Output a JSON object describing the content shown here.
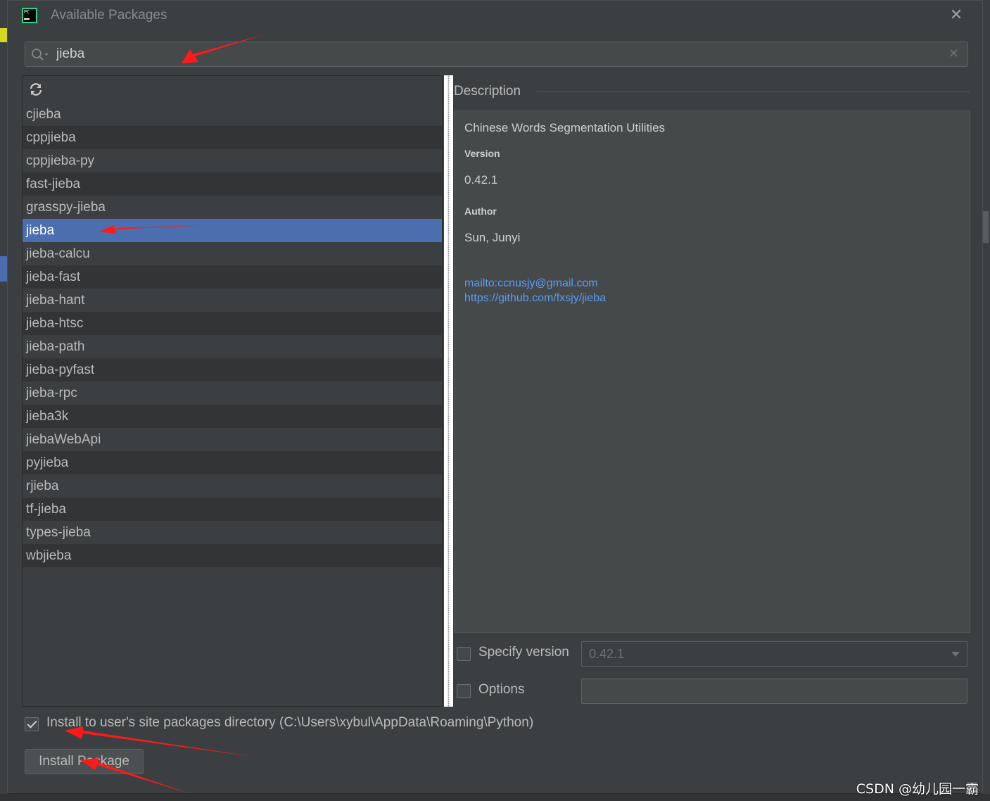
{
  "window": {
    "title": "Available Packages",
    "app_icon_text": "PC"
  },
  "search": {
    "value": "jieba"
  },
  "packages": [
    "cjieba",
    "cppjieba",
    "cppjieba-py",
    "fast-jieba",
    "grasspy-jieba",
    "jieba",
    "jieba-calcu",
    "jieba-fast",
    "jieba-hant",
    "jieba-htsc",
    "jieba-path",
    "jieba-pyfast",
    "jieba-rpc",
    "jieba3k",
    "jiebaWebApi",
    "pyjieba",
    "rjieba",
    "tf-jieba",
    "types-jieba",
    "wbjieba"
  ],
  "selected_package": "jieba",
  "description": {
    "label": "Description",
    "summary": "Chinese Words Segmentation Utilities",
    "version_heading": "Version",
    "version": "0.42.1",
    "author_heading": "Author",
    "author": "Sun, Junyi",
    "links": [
      "mailto:ccnusjy@gmail.com",
      "https://github.com/fxsjy/jieba"
    ]
  },
  "options": {
    "specify_version_label": "Specify version",
    "specify_version_checked": false,
    "version_value": "0.42.1",
    "options_label": "Options",
    "options_checked": false,
    "options_value": "",
    "install_user_label": "Install to user's site packages directory (C:\\Users\\xybul\\AppData\\Roaming\\Python)",
    "install_user_checked": true
  },
  "buttons": {
    "install": "Install Package"
  },
  "watermark": "CSDN @幼儿园一霸",
  "colors": {
    "selection": "#4b6eaf",
    "link": "#589df6",
    "annotation_arrow": "#ff1a1a"
  }
}
